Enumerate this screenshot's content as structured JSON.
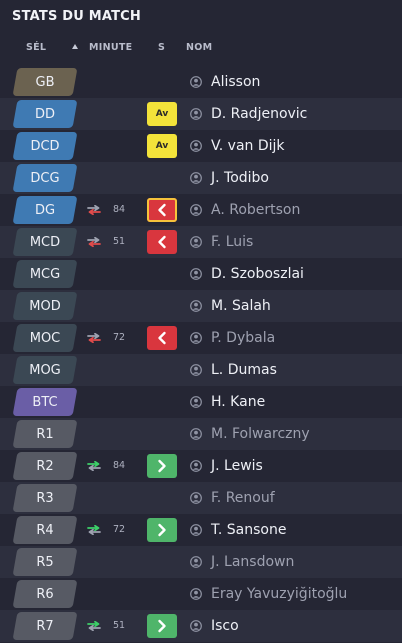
{
  "panel": {
    "title": "STATS DU MATCH"
  },
  "columns": {
    "sel": "SÉL",
    "minute": "MINUTE",
    "s": "S",
    "nom": "NOM"
  },
  "colors": {
    "gk": "#6b6250",
    "def": "#3f7ab3",
    "mid": "#3b4854",
    "att": "#6a5ea6",
    "sub": "#575a64",
    "av_yellow": "#f3e33a",
    "out_red": "#d9363e",
    "in_green": "#4fb56a",
    "sub_out_arrow": "#e14b4b",
    "sub_in_arrow": "#3ccf68",
    "sub_neutral": "#9ea2b0"
  },
  "players": [
    {
      "pos": "GB",
      "pos_style": "gk",
      "minute": "",
      "status": "",
      "status_label": "",
      "name": "Alisson",
      "dim": false
    },
    {
      "pos": "DD",
      "pos_style": "def",
      "minute": "",
      "status": "av",
      "status_label": "Av",
      "name": "D. Radjenovic",
      "dim": false
    },
    {
      "pos": "DCD",
      "pos_style": "def",
      "minute": "",
      "status": "av",
      "status_label": "Av",
      "name": "V. van Dijk",
      "dim": false
    },
    {
      "pos": "DCG",
      "pos_style": "def",
      "minute": "",
      "status": "",
      "status_label": "",
      "name": "J. Todibo",
      "dim": false
    },
    {
      "pos": "DG",
      "pos_style": "def",
      "minute": "84",
      "sub_icon": "swap-out",
      "status": "out-bordered",
      "status_label": "",
      "name": "A. Robertson",
      "dim": true
    },
    {
      "pos": "MCD",
      "pos_style": "mid",
      "minute": "51",
      "sub_icon": "swap-out",
      "status": "out",
      "status_label": "",
      "name": "F. Luis",
      "dim": true
    },
    {
      "pos": "MCG",
      "pos_style": "mid",
      "minute": "",
      "status": "",
      "status_label": "",
      "name": "D. Szoboszlai",
      "dim": false
    },
    {
      "pos": "MOD",
      "pos_style": "mid",
      "minute": "",
      "status": "",
      "status_label": "",
      "name": "M. Salah",
      "dim": false
    },
    {
      "pos": "MOC",
      "pos_style": "mid",
      "minute": "72",
      "sub_icon": "swap-out",
      "status": "out",
      "status_label": "",
      "name": "P. Dybala",
      "dim": true
    },
    {
      "pos": "MOG",
      "pos_style": "mid",
      "minute": "",
      "status": "",
      "status_label": "",
      "name": "L. Dumas",
      "dim": false
    },
    {
      "pos": "BTC",
      "pos_style": "att",
      "minute": "",
      "status": "",
      "status_label": "",
      "name": "H. Kane",
      "dim": false
    },
    {
      "pos": "R1",
      "pos_style": "sub",
      "minute": "",
      "status": "",
      "status_label": "",
      "name": "M. Folwarczny",
      "dim": true
    },
    {
      "pos": "R2",
      "pos_style": "sub",
      "minute": "84",
      "sub_icon": "swap-in",
      "status": "in",
      "status_label": "",
      "name": "J. Lewis",
      "dim": false
    },
    {
      "pos": "R3",
      "pos_style": "sub",
      "minute": "",
      "status": "",
      "status_label": "",
      "name": "F. Renouf",
      "dim": true
    },
    {
      "pos": "R4",
      "pos_style": "sub",
      "minute": "72",
      "sub_icon": "swap-in",
      "status": "in",
      "status_label": "",
      "name": "T. Sansone",
      "dim": false
    },
    {
      "pos": "R5",
      "pos_style": "sub",
      "minute": "",
      "status": "",
      "status_label": "",
      "name": "J. Lansdown",
      "dim": true
    },
    {
      "pos": "R6",
      "pos_style": "sub",
      "minute": "",
      "status": "",
      "status_label": "",
      "name": "Eray Yavuzyiğitoğlu",
      "dim": true
    },
    {
      "pos": "R7",
      "pos_style": "sub",
      "minute": "51",
      "sub_icon": "swap-in",
      "status": "in",
      "status_label": "",
      "name": "Isco",
      "dim": false
    }
  ]
}
